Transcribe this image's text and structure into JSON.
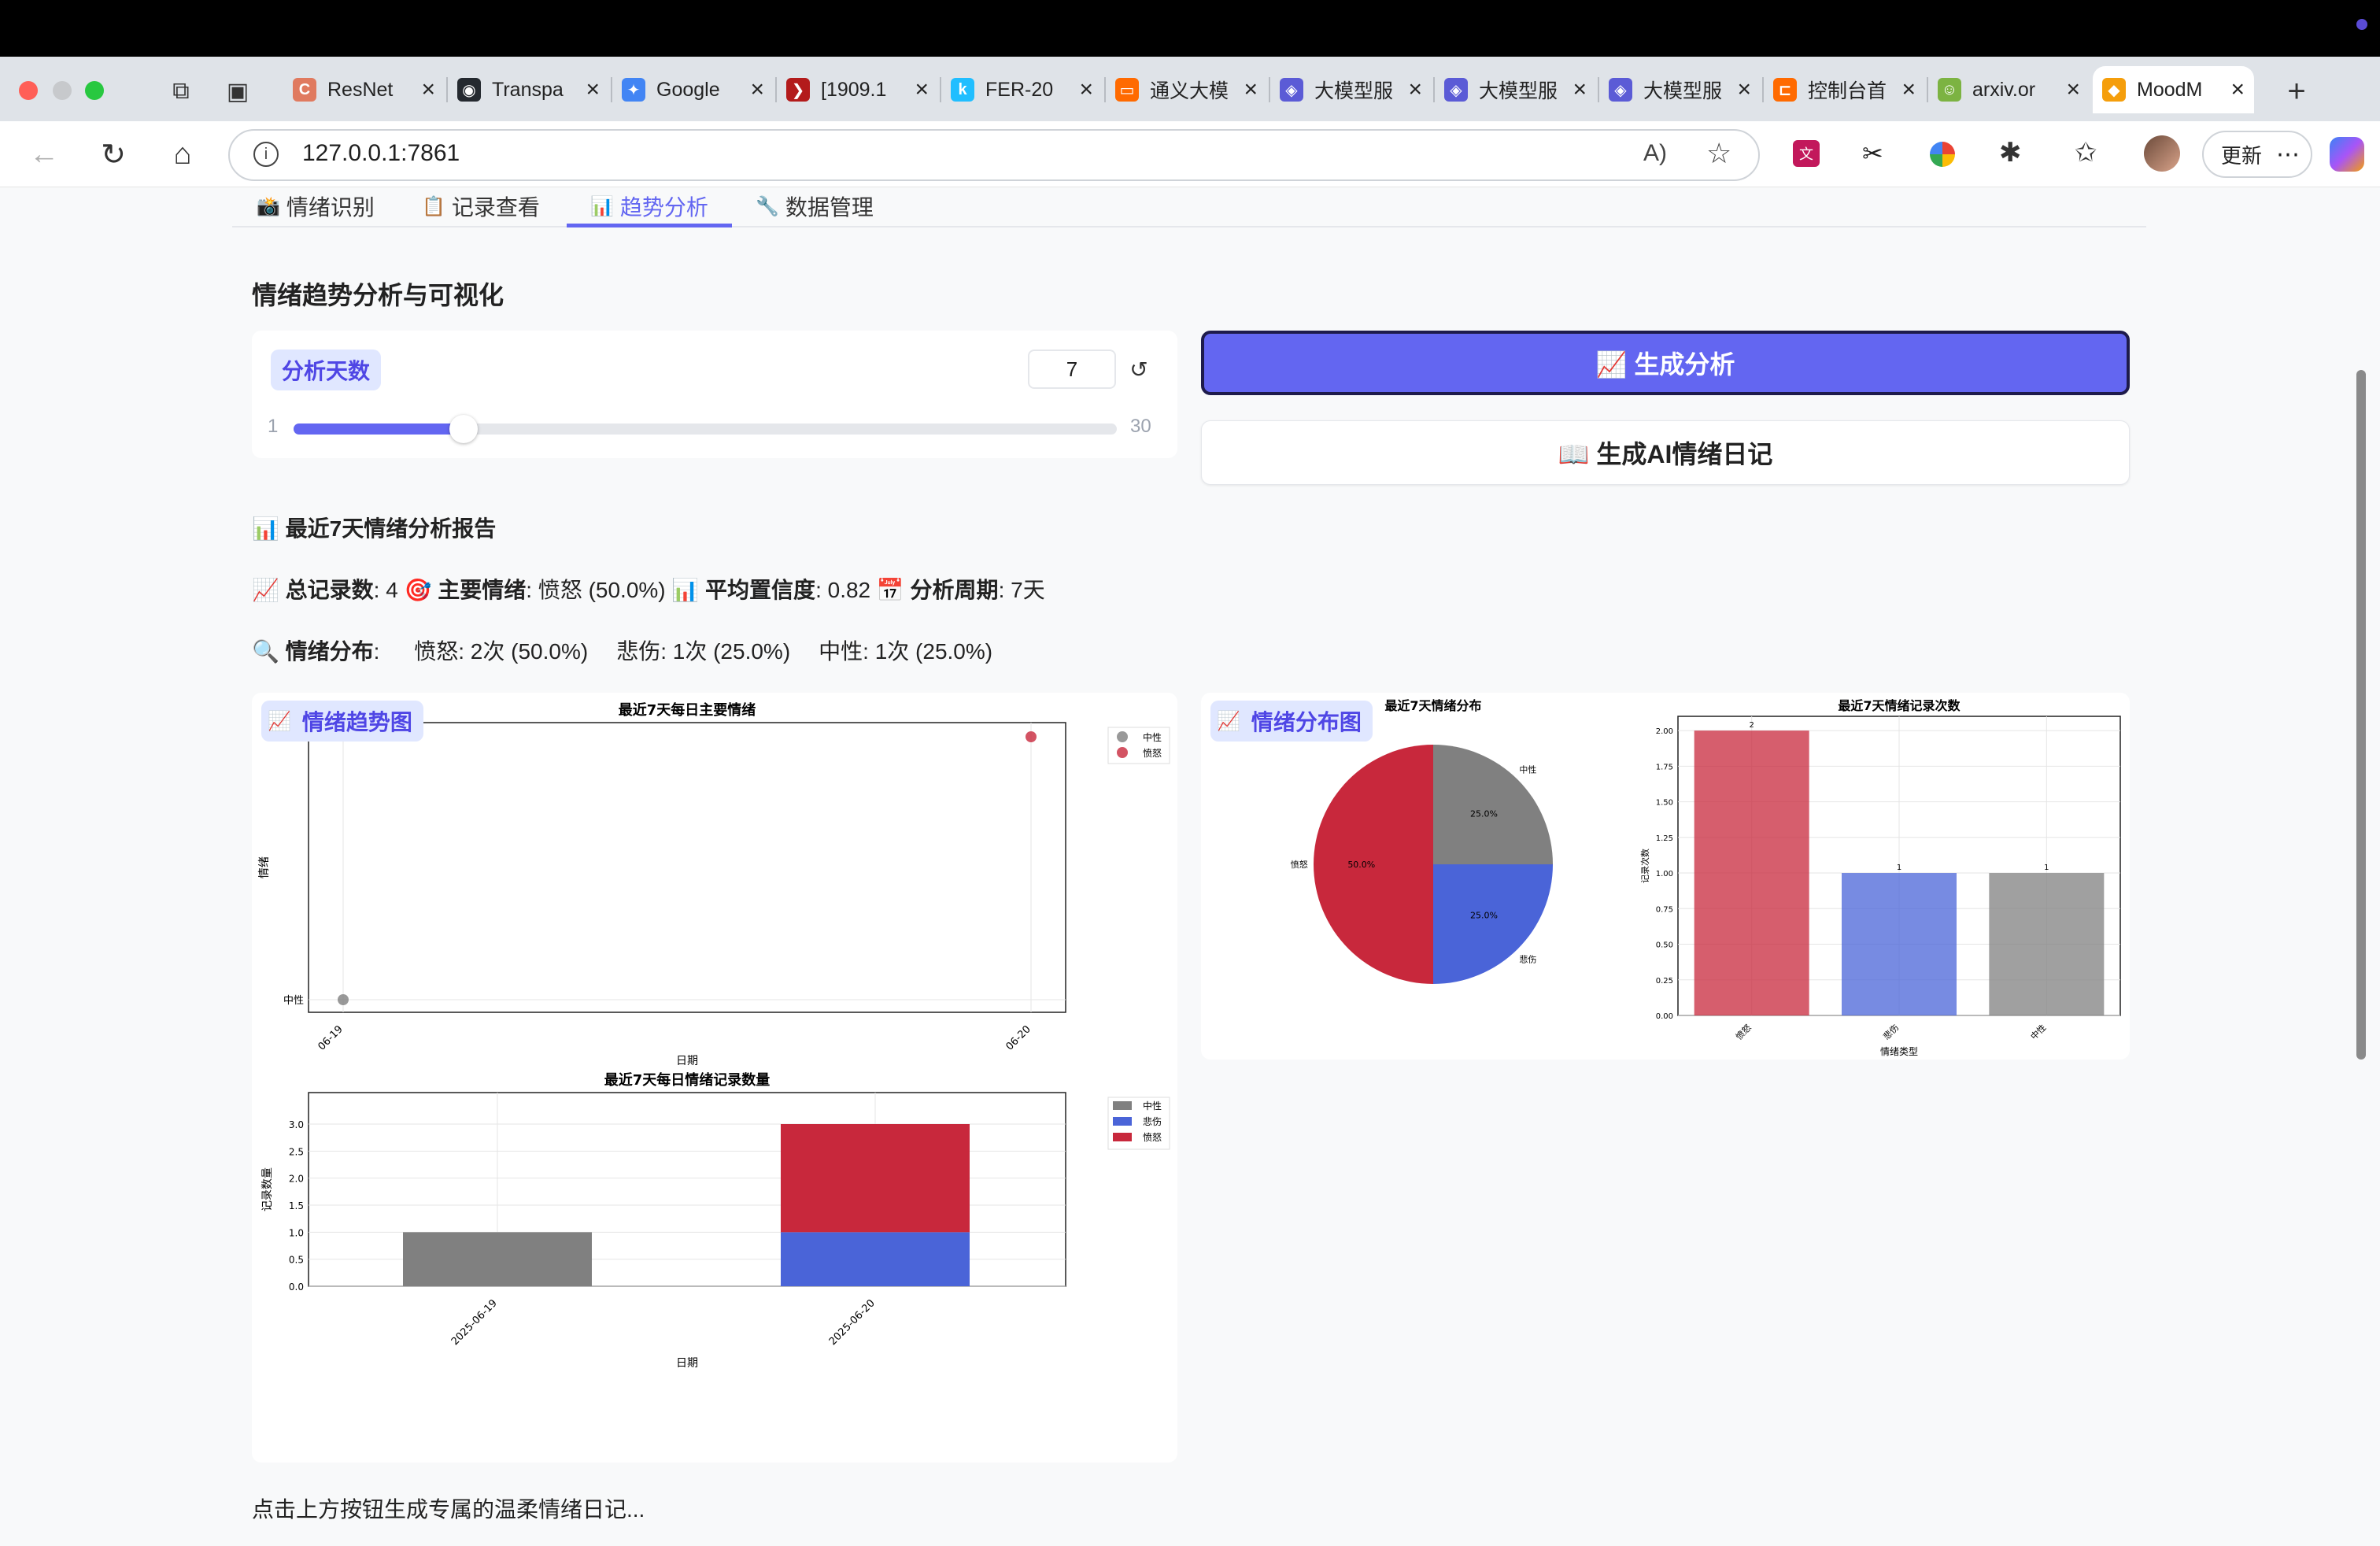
{
  "browser": {
    "tabs": [
      {
        "title": "ResNet",
        "fav": "C",
        "color": "#e07a5f"
      },
      {
        "title": "Transpa",
        "fav": "◉",
        "color": "#24292f"
      },
      {
        "title": "Google",
        "fav": "✦",
        "color": "#4285f4"
      },
      {
        "title": "[1909.1",
        "fav": "❯",
        "color": "#b31b1b"
      },
      {
        "title": "FER-20",
        "fav": "k",
        "color": "#20beff"
      },
      {
        "title": "通义大模",
        "fav": "▭",
        "color": "#ff6a00"
      },
      {
        "title": "大模型服",
        "fav": "◈",
        "color": "#5b5bd6"
      },
      {
        "title": "大模型服",
        "fav": "◈",
        "color": "#5b5bd6"
      },
      {
        "title": "大模型服",
        "fav": "◈",
        "color": "#5b5bd6"
      },
      {
        "title": "控制台首",
        "fav": "⊏",
        "color": "#ff6a00"
      },
      {
        "title": "arxiv.or",
        "fav": "☺",
        "color": "#7cb342"
      },
      {
        "title": "MoodM",
        "fav": "◆",
        "color": "#f59e0b"
      }
    ],
    "new_tab": "+",
    "url": "127.0.0.1:7861",
    "update_label": "更新",
    "more_label": "⋯"
  },
  "nav": {
    "tabs": [
      {
        "icon": "📸",
        "label": "情绪识别"
      },
      {
        "icon": "📋",
        "label": "记录查看"
      },
      {
        "icon": "📊",
        "label": "趋势分析"
      },
      {
        "icon": "🔧",
        "label": "数据管理"
      }
    ],
    "active": 2
  },
  "trend": {
    "section_title": "情绪趋势分析与可视化",
    "days_label": "分析天数",
    "days_value": "7",
    "reset_icon": "↺",
    "slider": {
      "min": "1",
      "max": "30",
      "value": 7
    },
    "generate_label": "📈 生成分析",
    "diary_label": "📖 生成AI情绪日记"
  },
  "report": {
    "title_icon": "📊",
    "title": "最近7天情绪分析报告",
    "line2": [
      {
        "icon": "📈",
        "key": "总记录数",
        "val": ": 4 "
      },
      {
        "icon": "🎯",
        "key": "主要情绪",
        "val": ": 愤怒 (50.0%) "
      },
      {
        "icon": "📊",
        "key": "平均置信度",
        "val": ": 0.82 "
      },
      {
        "icon": "📅",
        "key": "分析周期",
        "val": ": 7天"
      }
    ],
    "dist_icon": "🔍",
    "dist_key": "情绪分布",
    "dist_items": [
      "愤怒: 2次 (50.0%)",
      "悲伤: 1次 (25.0%)",
      "中性: 1次 (25.0%)"
    ]
  },
  "colors": {
    "anger": "#c8283c",
    "sad": "#4a64d8",
    "neutral": "#808080",
    "accent": "#6366f1"
  },
  "plots": {
    "trend_label": "情绪趋势图",
    "dist_label": "情绪分布图",
    "icon": "chart-icon"
  },
  "chart_data": [
    {
      "type": "scatter",
      "title": "最近7天每日主要情绪",
      "xlabel": "日期",
      "ylabel": "情绪",
      "x_ticks": [
        "06-19",
        "06-20"
      ],
      "y_ticks": [
        "中性"
      ],
      "series": [
        {
          "name": "中性",
          "points": [
            {
              "x": "06-19",
              "y": "中性"
            }
          ]
        },
        {
          "name": "愤怒",
          "points": [
            {
              "x": "06-20",
              "y": "愤怒"
            }
          ]
        }
      ],
      "legend": "top-right",
      "grid": true
    },
    {
      "type": "bar",
      "stacked": true,
      "title": "最近7天每日情绪记录数量",
      "xlabel": "日期",
      "ylabel": "记录数量",
      "categories": [
        "2025-06-19",
        "2025-06-20"
      ],
      "series": [
        {
          "name": "中性",
          "values": [
            1,
            0
          ]
        },
        {
          "name": "悲伤",
          "values": [
            0,
            1
          ]
        },
        {
          "name": "愤怒",
          "values": [
            0,
            2
          ]
        }
      ],
      "y_ticks": [
        "0.0",
        "0.5",
        "1.0",
        "1.5",
        "2.0",
        "2.5",
        "3.0"
      ],
      "ylim": [
        0,
        3
      ],
      "legend": "top-right",
      "grid": true
    },
    {
      "type": "pie",
      "title": "最近7天情绪分布",
      "labels": [
        "愤怒",
        "悲伤",
        "中性"
      ],
      "values": [
        50.0,
        25.0,
        25.0
      ],
      "value_labels": [
        "50.0%",
        "25.0%",
        "25.0%"
      ]
    },
    {
      "type": "bar",
      "title": "最近7天情绪记录次数",
      "xlabel": "情绪类型",
      "ylabel": "记录次数",
      "categories": [
        "愤怒",
        "悲伤",
        "中性"
      ],
      "values": [
        2,
        1,
        1
      ],
      "y_ticks": [
        "0.00",
        "0.25",
        "0.50",
        "0.75",
        "1.00",
        "1.25",
        "1.50",
        "1.75",
        "2.00"
      ],
      "ylim": [
        0,
        2.1
      ],
      "grid": true
    }
  ],
  "bottom_text": "点击上方按钮生成专属的温柔情绪日记..."
}
